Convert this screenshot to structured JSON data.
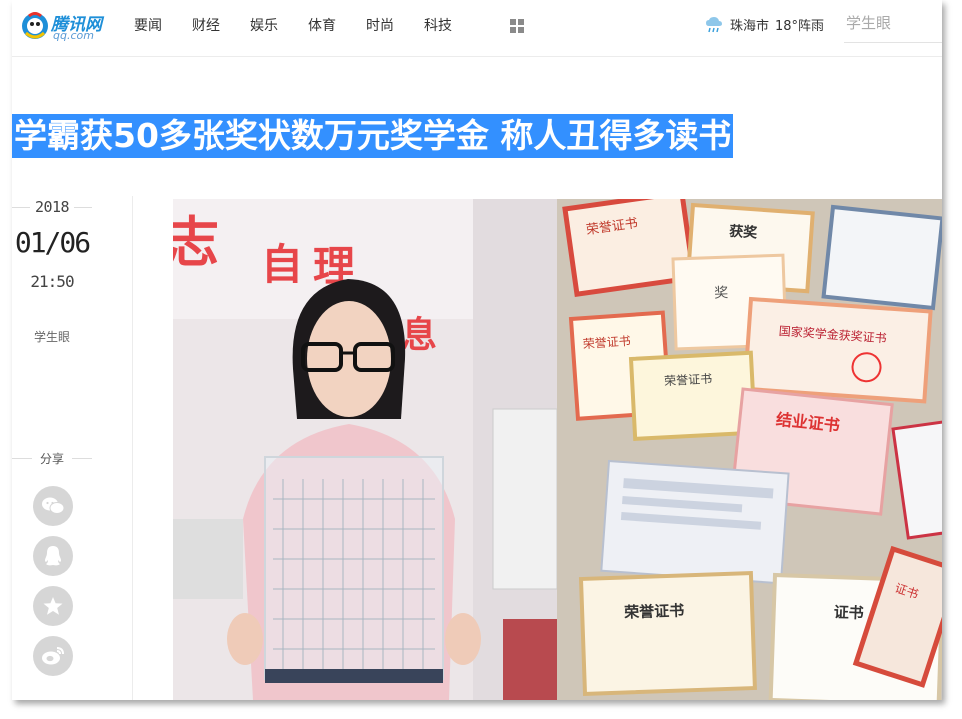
{
  "header": {
    "logo_main": "腾讯网",
    "logo_sub": "qq.com",
    "nav": [
      "要闻",
      "财经",
      "娱乐",
      "体育",
      "时尚",
      "科技"
    ],
    "weather_city": "珠海市",
    "weather_temp": "18°阵雨",
    "search_placeholder": "学生眼"
  },
  "article": {
    "title": "学霸获50多张奖状数万元奖学金 称人丑得多读书",
    "year": "2018",
    "date": "01/06",
    "time": "21:50",
    "author": "学生眼",
    "share_label": "分享",
    "share_buttons": [
      "wechat-icon",
      "qq-icon",
      "qzone-icon",
      "weibo-icon"
    ]
  },
  "photo": {
    "wall_chars": [
      "志",
      "自",
      "理",
      "息"
    ],
    "certificate_texts": [
      "荣誉证书",
      "获奖",
      "荣誉证书",
      "奖",
      "国家奖学金获奖证书",
      "荣誉证书",
      "结业证书",
      "荣誉证书",
      "证书",
      "证书"
    ]
  },
  "colors": {
    "title_highlight": "#3390ff",
    "brand_blue": "#1e8fd8"
  }
}
